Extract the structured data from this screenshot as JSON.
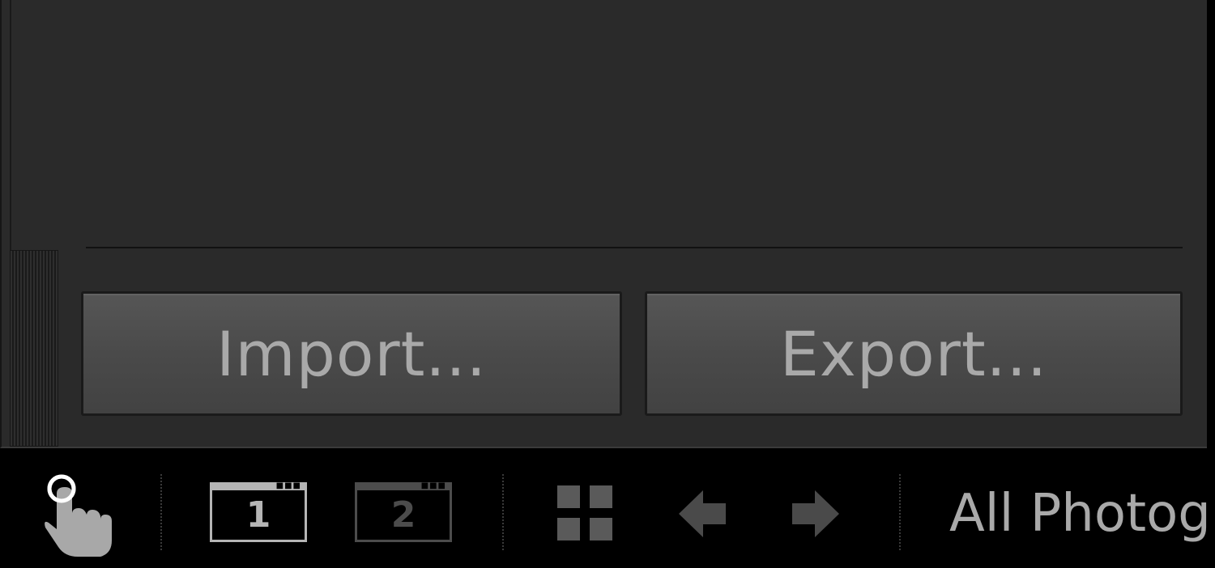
{
  "panel": {
    "import_label": "Import...",
    "export_label": "Export..."
  },
  "toolbar": {
    "hand_tool_icon": "hand-pointer-icon",
    "window_1_label": "1",
    "window_2_label": "2",
    "grid_icon": "grid-view-icon",
    "prev_icon": "arrow-left-icon",
    "next_icon": "arrow-right-icon",
    "source_label": "All Photog"
  },
  "colors": {
    "panel_bg": "#2a2a2a",
    "button_bg": "#4a4a4a",
    "button_text": "#a9a9a9",
    "toolbar_bg": "#000000",
    "icon_active": "#b5b5b5",
    "icon_inactive": "#4c4c4c"
  }
}
